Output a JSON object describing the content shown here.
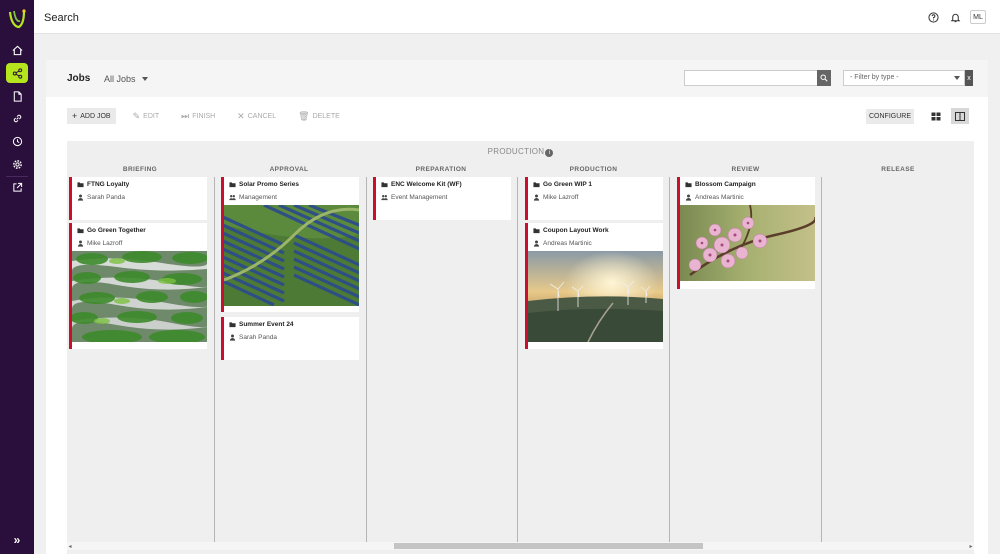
{
  "app": {
    "title": "Search",
    "user_initials": "ML"
  },
  "nav": {
    "items": [
      {
        "name": "home-icon"
      },
      {
        "name": "share-icon",
        "active": true
      },
      {
        "name": "document-icon"
      },
      {
        "name": "link-icon"
      },
      {
        "name": "clock-icon"
      },
      {
        "name": "gear-icon"
      },
      {
        "name": "external-link-icon"
      }
    ],
    "expand_label": "»"
  },
  "jobs": {
    "title": "Jobs",
    "view_label": "All Jobs",
    "search_placeholder": "",
    "filter_placeholder": "- Filter by type -",
    "filter_clear": "x"
  },
  "toolbar": {
    "add": "ADD JOB",
    "edit": "EDIT",
    "finish": "FINISH",
    "cancel": "CANCEL",
    "delete": "DELETE",
    "configure": "CONFIGURE"
  },
  "board": {
    "group_label": "PRODUCTION",
    "columns": [
      {
        "label": "BRIEFING"
      },
      {
        "label": "APPROVAL"
      },
      {
        "label": "PREPARATION"
      },
      {
        "label": "PRODUCTION"
      },
      {
        "label": "REVIEW"
      },
      {
        "label": "RELEASE"
      }
    ],
    "cards": {
      "briefing": [
        {
          "title": "FTNG Loyalty",
          "owner": "Sarah Panda",
          "owner_type": "person"
        },
        {
          "title": "Go Green Together",
          "owner": "Mike Lazroff",
          "owner_type": "person",
          "image": "green-building"
        }
      ],
      "approval": [
        {
          "title": "Solar Promo Series",
          "owner": "Management",
          "owner_type": "group",
          "image": "solar-field"
        },
        {
          "title": "Summer Event 24",
          "owner": "Sarah Panda",
          "owner_type": "person"
        }
      ],
      "preparation": [
        {
          "title": "ENC Welcome Kit (WF)",
          "owner": "Event Management",
          "owner_type": "group"
        }
      ],
      "production": [
        {
          "title": "Go Green WIP 1",
          "owner": "Mike Lazroff",
          "owner_type": "person"
        },
        {
          "title": "Coupon Layout Work",
          "owner": "Andreas Martinic",
          "owner_type": "person",
          "image": "wind-turbines"
        }
      ],
      "review": [
        {
          "title": "Blossom Campaign",
          "owner": "Andreas Martinic",
          "owner_type": "person",
          "image": "cherry-blossom"
        }
      ]
    }
  },
  "colors": {
    "sidebar": "#2a0f3c",
    "accent": "#b5e61d",
    "card_border": "#c8102e"
  }
}
